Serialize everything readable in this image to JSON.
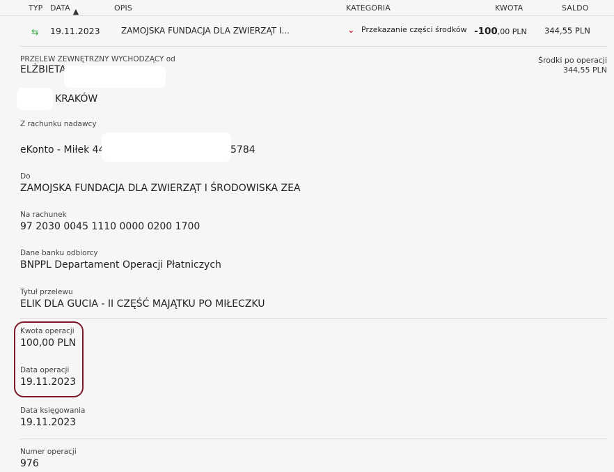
{
  "header": {
    "typ": "TYP",
    "data": "DATA",
    "opis": "OPIS",
    "kategoria": "KATEGORIA",
    "kwota": "KWOTA",
    "saldo": "SALDO"
  },
  "transaction": {
    "date": "19.11.2023",
    "description": "ZAMOJSKA FUNDACJA DLA ZWIERZĄT I...",
    "category": "Przekazanie części środków",
    "amount_major": "-100",
    "amount_minor": ",00 PLN",
    "balance": "344,55 PLN"
  },
  "details": {
    "type_label": "PRZELEW ZEWNĘTRZNY WYCHODZĄCY od",
    "sender_name": "ELŻBIETA",
    "sender_city": "KRAKÓW",
    "balance_after_label": "Środki po operacji",
    "balance_after_value": "344,55 PLN",
    "from_account_label": "Z rachunku nadawcy",
    "from_account_name": "eKonto - Miłek 44",
    "from_account_suffix": "5784",
    "to_label": "Do",
    "to_value": "ZAMOJSKA FUNDACJA DLA ZWIERZĄT I ŚRODOWISKA ZEA",
    "account_label": "Na rachunek",
    "account_value": "97 2030 0045 1110 0000 0200 1700",
    "bank_label": "Dane banku odbiorcy",
    "bank_value": "BNPPL Departament Operacji Płatniczych",
    "title_label": "Tytuł przelewu",
    "title_value": "ELIK DLA GUCIA - II CZĘŚĆ MAJĄTKU PO MIŁECZKU",
    "op_amount_label": "Kwota operacji",
    "op_amount_value": "100,00 PLN",
    "op_date_label": "Data operacji",
    "op_date_value": "19.11.2023",
    "posting_date_label": "Data księgowania",
    "posting_date_value": "19.11.2023",
    "op_number_label": "Numer operacji",
    "op_number_value": "976"
  },
  "colors": {
    "accent_red": "#d0021b",
    "highlight_border": "#7a1a2a",
    "transfer_icon": "#2e9d3a"
  }
}
